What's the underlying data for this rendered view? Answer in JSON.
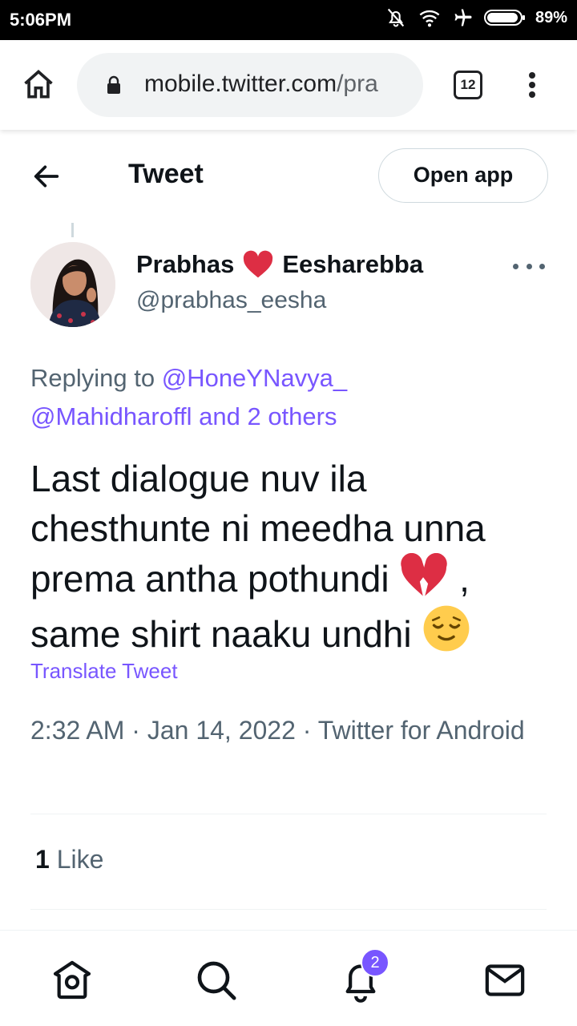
{
  "status_bar": {
    "time": "5:06PM",
    "battery": "89%",
    "icons": [
      "bell-off-icon",
      "wifi-icon",
      "airplane-icon",
      "battery-icon"
    ]
  },
  "browser": {
    "url_domain": "mobile.twitter.com",
    "url_path": "/pra",
    "tab_count": "12"
  },
  "header": {
    "title": "Tweet",
    "open_app": "Open app"
  },
  "tweet": {
    "author_name_1": "Prabhas",
    "author_name_2": "Eesharebba",
    "handle": "@prabhas_eesha",
    "replying_prefix": "Replying to",
    "reply_mention_1": "@HoneYNavya_",
    "reply_mention_2": "@Mahidharoffl",
    "reply_others": "and 2 others",
    "text_1": "Last dialogue nuv ila chesthunte ni meedha unna prema antha pothundi",
    "text_2": ", same shirt naaku  undhi",
    "translate": "Translate Tweet",
    "timestamp": "2:32 AM · Jan 14, 2022 · Twitter for Android",
    "like_count": "1",
    "like_label": "Like"
  },
  "nav": {
    "notification_badge": "2",
    "items": [
      "home-icon",
      "search-icon",
      "notifications-icon",
      "messages-icon"
    ]
  },
  "colors": {
    "accent": "#7856ff",
    "secondary_text": "#536471",
    "primary_text": "#0f1419",
    "heart": "#e0245e"
  }
}
